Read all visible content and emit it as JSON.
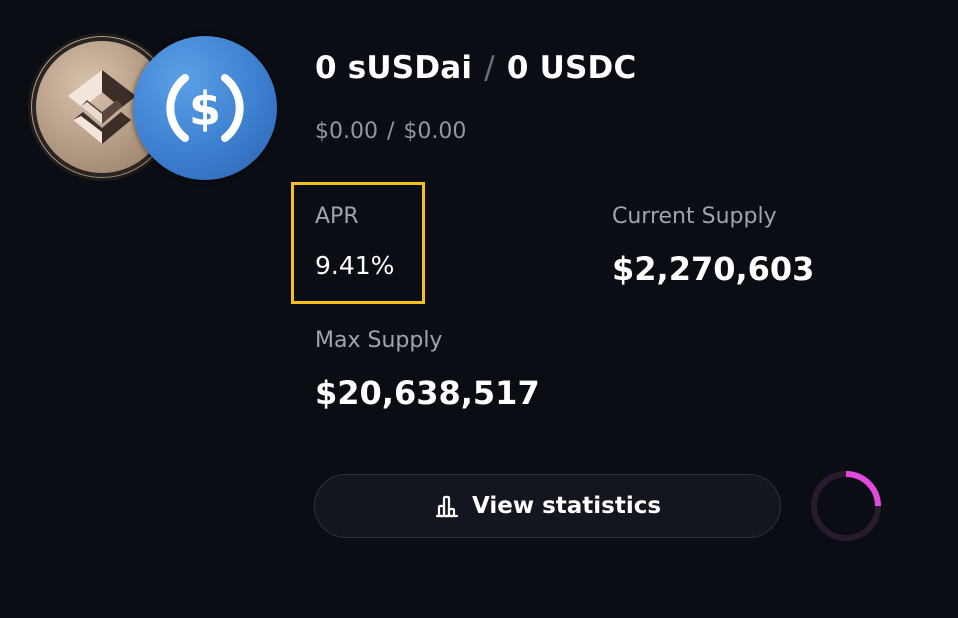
{
  "pair": {
    "token_a_amount": "0 sUSDai",
    "separator": "/",
    "token_b_amount": "0 USDC",
    "token_a_usd": "$0.00",
    "usd_separator": "/",
    "token_b_usd": "$0.00"
  },
  "icons": {
    "token_a": "susdai-token-icon",
    "token_b": "usdc-token-icon",
    "button": "bar-chart-icon",
    "loading": "loading-spinner"
  },
  "stats": {
    "apr_label": "APR",
    "apr_value": "9.41%",
    "current_supply_label": "Current Supply",
    "current_supply_value": "$2,270,603",
    "max_supply_label": "Max Supply",
    "max_supply_value": "$20,638,517"
  },
  "actions": {
    "view_statistics_label": "View statistics"
  },
  "colors": {
    "background": "#0b0d14",
    "highlight_border": "#f5c01c",
    "usdc_blue": "#3d7fd0",
    "spinner_accent": "#e04bdc"
  }
}
